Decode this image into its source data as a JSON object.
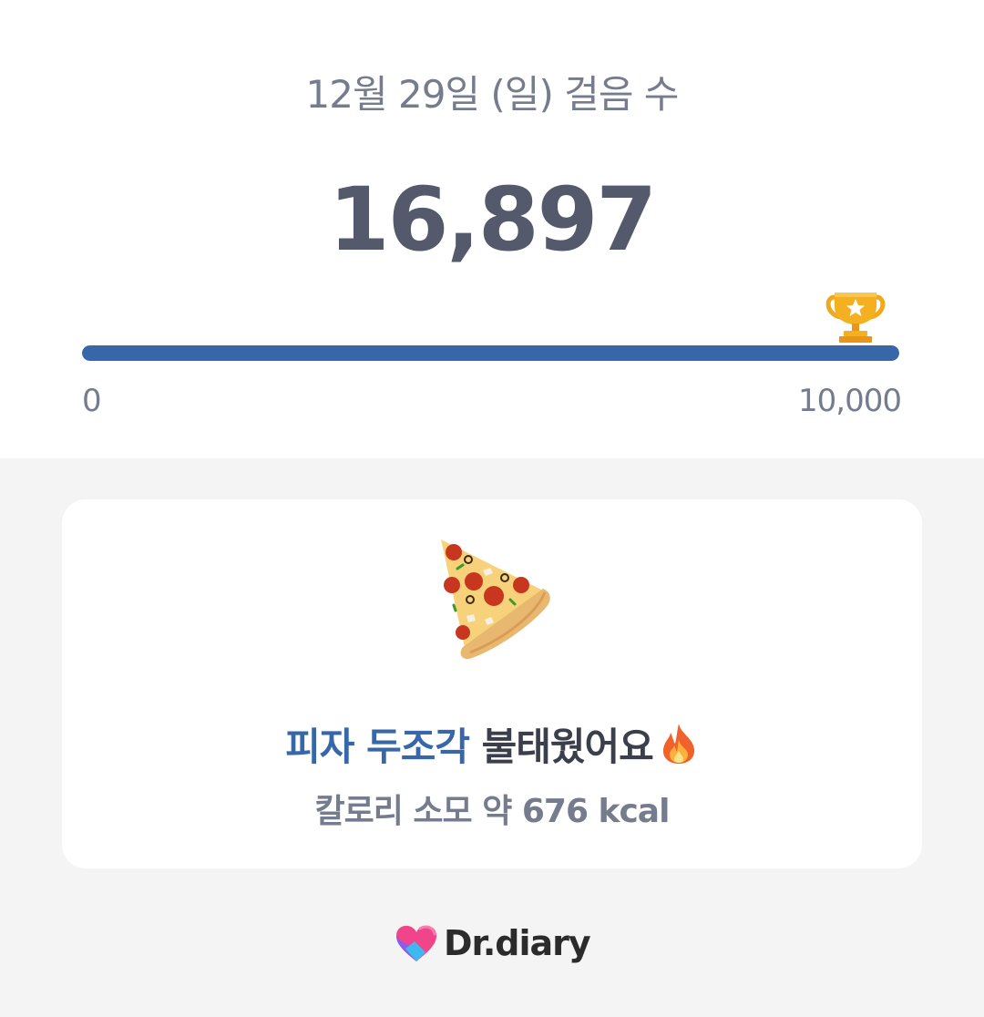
{
  "header": {
    "date_title": "12월 29일 (일) 걸음 수",
    "step_count": "16,897"
  },
  "progress": {
    "min_label": "0",
    "max_label": "10,000",
    "fraction": 1.0,
    "fill_color": "#3767a8",
    "goal_icon": "trophy-icon"
  },
  "card": {
    "food_icon": "pizza-icon",
    "headline_highlight": "피자 두조각",
    "headline_rest": "불태웠어요",
    "headline_icon": "fire-icon",
    "calorie_text": "칼로리 소모 약 676 kcal"
  },
  "brand": {
    "name": "Dr.diary",
    "logo_icon": "heart-logo-icon"
  },
  "colors": {
    "accent": "#3767a8",
    "text_gray": "#757c8e",
    "text_dark": "#545a6c"
  }
}
